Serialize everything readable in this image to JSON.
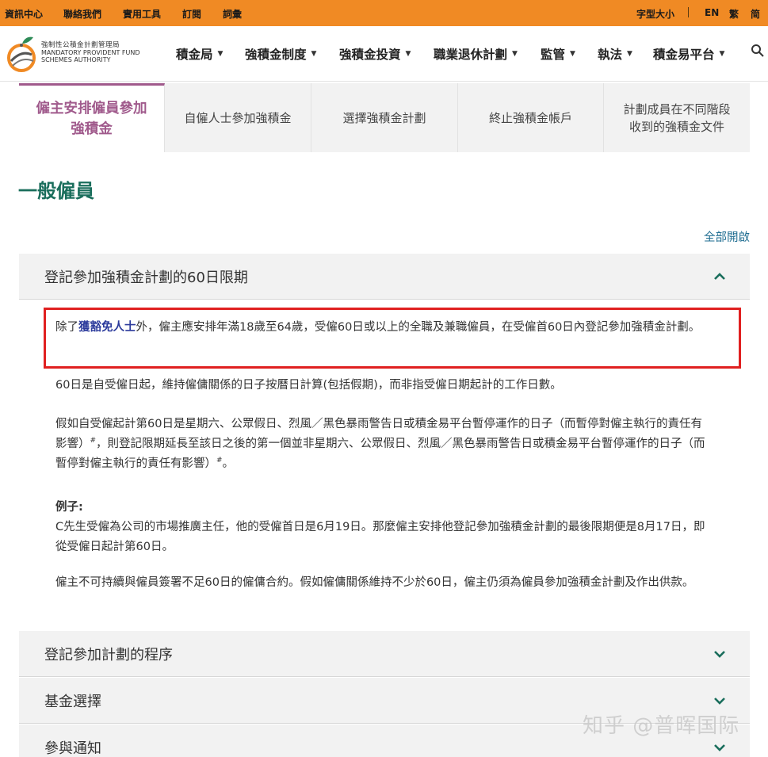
{
  "topbar": {
    "left_links": [
      "資訊中心",
      "聯絡我們",
      "實用工具",
      "訂閱",
      "詞彙"
    ],
    "font_size_label": "字型大小",
    "lang_en": "EN",
    "lang_tc": "繁",
    "lang_sc": "简"
  },
  "logo": {
    "zh": "強制性公積金計劃管理局",
    "en_line1": "MANDATORY PROVIDENT FUND",
    "en_line2": "SCHEMES AUTHORITY"
  },
  "nav": {
    "items": [
      "積金局",
      "強積金制度",
      "強積金投資",
      "職業退休計劃",
      "監管",
      "執法",
      "積金易平台"
    ],
    "search_icon": "search-icon"
  },
  "tabs": [
    {
      "label": "僱主安排僱員參加強積金",
      "active": true
    },
    {
      "label": "自僱人士參加強積金",
      "active": false
    },
    {
      "label": "選擇強積金計劃",
      "active": false
    },
    {
      "label": "終止強積金帳戶",
      "active": false
    },
    {
      "label": "計劃成員在不同階段收到的強積金文件",
      "active": false
    }
  ],
  "section_title": "一般僱員",
  "expand_all": "全部開啟",
  "accordions": [
    {
      "title": "登記參加強積金計劃的60日限期",
      "expanded": true
    },
    {
      "title": "登記參加計劃的程序",
      "expanded": false
    },
    {
      "title": "基金選擇",
      "expanded": false
    },
    {
      "title": "參與通知",
      "expanded": false
    }
  ],
  "body": {
    "p1_prefix": "除了",
    "p1_link": "獲豁免人士",
    "p1_suffix": "外，僱主應安排年滿18歲至64歲，受僱60日或以上的全職及兼職僱員，在受僱首60日內登記參加強積金計劃。",
    "p2": "60日是自受僱日起，維持僱傭關係的日子按曆日計算(包括假期)，而非指受僱日期起計的工作日數。",
    "p3_a": "假如自受僱起計第60日是星期六、公眾假日、烈風／黑色暴雨警告日或積金易平台暫停運作的日子（而暫停對僱主執行的責任有影響）",
    "p3_sup1": "#",
    "p3_b": "，則登記限期延長至該日之後的第一個並非星期六、公眾假日、烈風／黑色暴雨警告日或積金易平台暫停運作的日子（而暫停對僱主執行的責任有影響）",
    "p3_sup2": "#",
    "p3_c": "。",
    "example_label": "例子:",
    "example_text": "C先生受僱為公司的市場推廣主任，他的受僱首日是6月19日。那麼僱主安排他登記參加強積金計劃的最後限期便是8月17日，即從受僱日起計第60日。",
    "p5": "僱主不可持續與僱員簽署不足60日的僱傭合約。假如僱傭關係維持不少於60日，僱主仍須為僱員參加強積金計劃及作出供款。"
  },
  "watermark": "知乎 @普晖国际",
  "colors": {
    "topbar": "#f08a24",
    "active_tab": "#a05a8c",
    "section_title": "#1a6e5c",
    "link": "#2c3b9c",
    "highlight": "#e02020"
  }
}
